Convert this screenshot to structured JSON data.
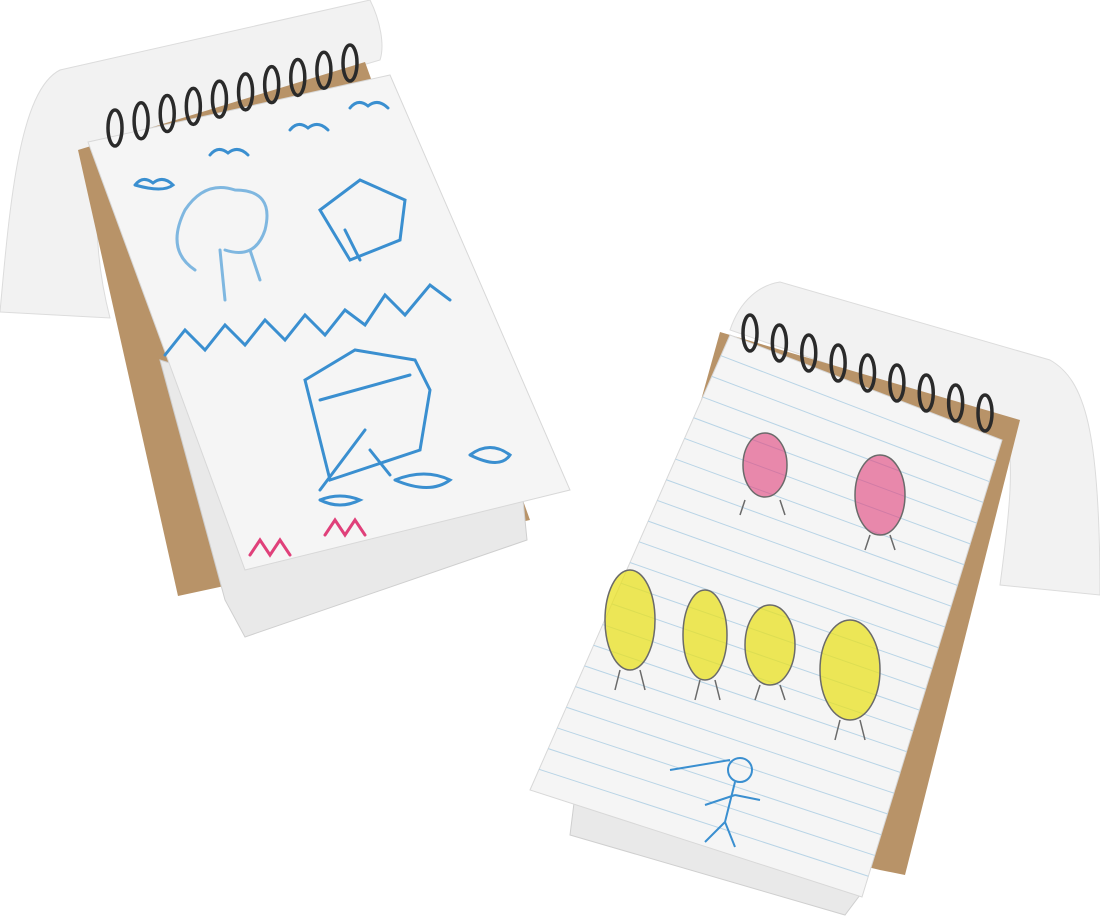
{
  "scene": {
    "background": "#ffffff",
    "objects": [
      "spiral-notebook-left",
      "spiral-notebook-right"
    ]
  },
  "colors": {
    "kraft": "#b89368",
    "page": "#f4f4f4",
    "spiral": "#2a2a2a",
    "crayon_blue": "#3a8fd0",
    "crayon_pink": "#e0407a",
    "crayon_yellow": "#e8e020",
    "pencil": "#6a6a6a",
    "ruled_line": "#b8d4e6"
  }
}
